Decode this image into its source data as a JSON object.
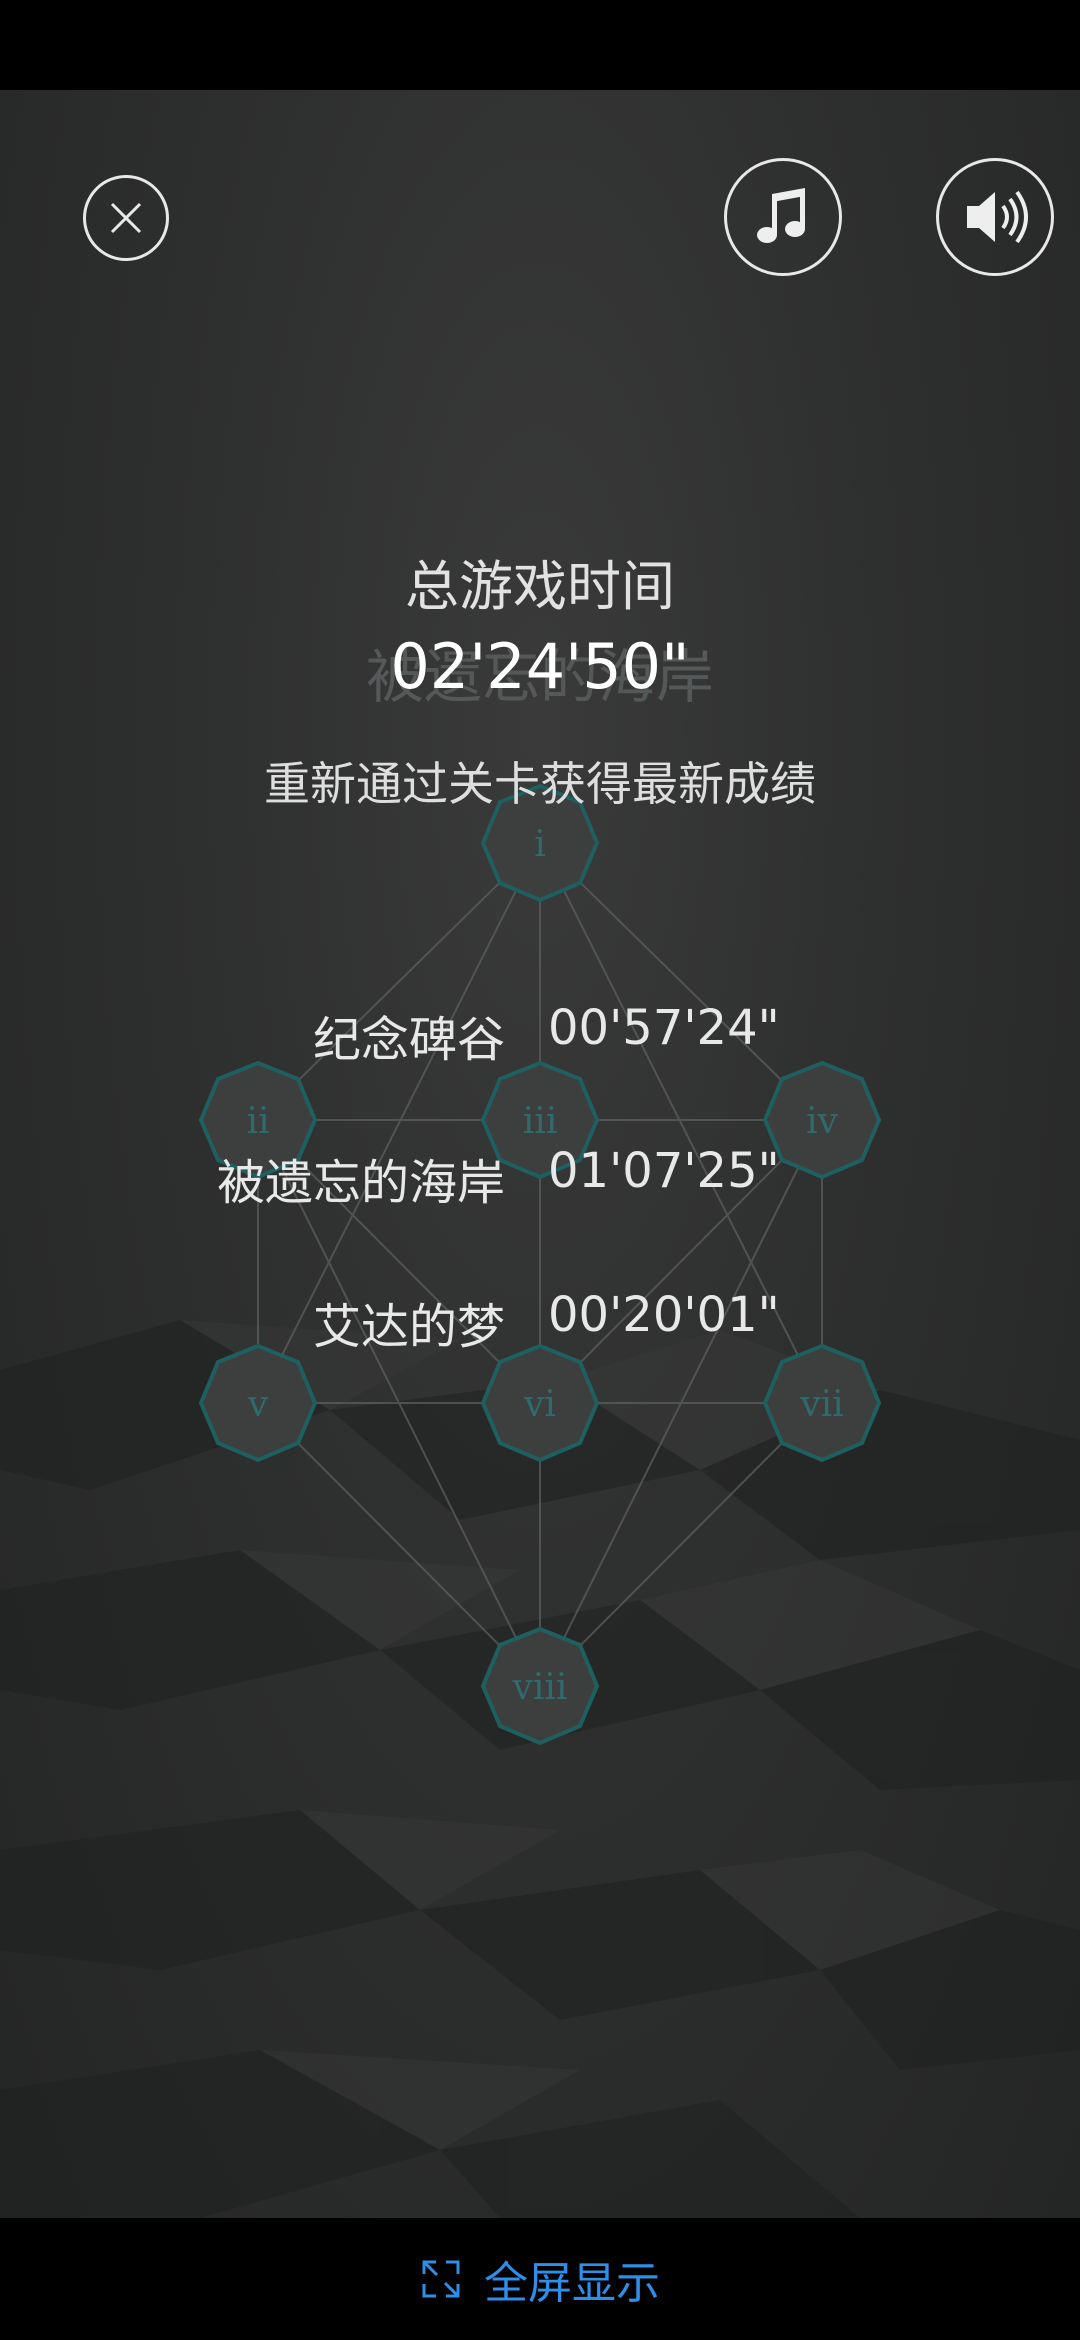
{
  "title": "总游戏时间",
  "faded_title": "被遗忘的海岸",
  "total_time": "02'24'50\"",
  "hint": "重新通过关卡获得最新成绩",
  "scores": [
    {
      "level": "纪念碑谷",
      "time": "00'57'24\""
    },
    {
      "level": "被遗忘的海岸",
      "time": "01'07'25\""
    },
    {
      "level": "艾达的梦",
      "time": "00'20'01\""
    }
  ],
  "level_nodes": [
    "i",
    "ii",
    "iii",
    "iv",
    "v",
    "vi",
    "vii",
    "viii"
  ],
  "bottom_bar": {
    "fullscreen_label": "全屏显示"
  },
  "icons": {
    "close": "close-icon",
    "music": "music-note-icon",
    "sound": "speaker-icon",
    "fullscreen": "expand-icon"
  },
  "colors": {
    "background": "#2e2f2f",
    "node_outline": "#1f5f60",
    "link": "#2f8ee8"
  }
}
